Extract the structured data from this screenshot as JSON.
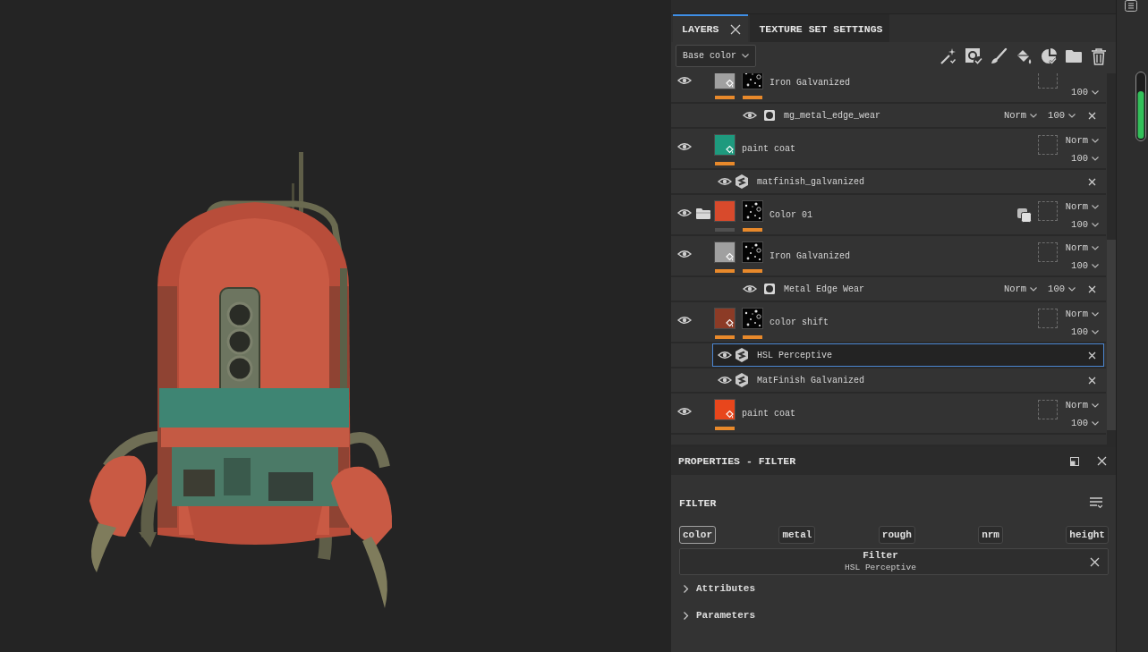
{
  "layers_panel": {
    "tabs": [
      {
        "label": "LAYERS",
        "selected": true,
        "closable": true
      },
      {
        "label": "TEXTURE SET SETTINGS",
        "selected": false,
        "closable": false
      }
    ],
    "channel_dropdown": {
      "value": "Base color"
    },
    "layers": [
      {
        "kind": "layer",
        "name": "Iron Galvanized",
        "visible": true,
        "selected": false,
        "linked": false,
        "thumbs": [
          {
            "kind": "fill",
            "color": "#a0a0a0",
            "active": true
          },
          {
            "kind": "mask",
            "active": true
          }
        ],
        "opacity": "100"
      },
      {
        "kind": "mask-generator",
        "name": "mg_metal_edge_wear",
        "visible": true,
        "selected": false,
        "blend": "Norm",
        "opacity": "100"
      },
      {
        "kind": "layer",
        "name": "paint coat",
        "visible": true,
        "selected": false,
        "linked": false,
        "thumbs": [
          {
            "kind": "fill",
            "color": "#1e9a7e",
            "active": true
          }
        ],
        "blend": "Norm",
        "opacity": "100"
      },
      {
        "kind": "filter",
        "name": "matfinish_galvanized",
        "visible": true,
        "selected": false
      },
      {
        "kind": "folder",
        "name": "Color 01",
        "visible": true,
        "selected": false,
        "linked": true,
        "thumbs": [
          {
            "kind": "texture",
            "color": "#d84a2c",
            "active": false
          },
          {
            "kind": "mask",
            "active": true
          }
        ],
        "blend": "Norm",
        "opacity": "100"
      },
      {
        "kind": "layer",
        "name": "Iron Galvanized",
        "visible": true,
        "selected": false,
        "linked": false,
        "thumbs": [
          {
            "kind": "fill",
            "color": "#a0a0a0",
            "active": true
          },
          {
            "kind": "mask",
            "active": true
          }
        ],
        "blend": "Norm",
        "opacity": "100"
      },
      {
        "kind": "mask-generator",
        "name": "Metal Edge Wear",
        "visible": true,
        "selected": false,
        "blend": "Norm",
        "opacity": "100"
      },
      {
        "kind": "layer",
        "name": "color shift",
        "visible": true,
        "selected": false,
        "linked": false,
        "thumbs": [
          {
            "kind": "fill",
            "color": "#8c3b26",
            "active": true
          },
          {
            "kind": "mask",
            "active": true
          }
        ],
        "blend": "Norm",
        "opacity": "100"
      },
      {
        "kind": "filter",
        "name": "HSL Perceptive",
        "visible": true,
        "selected": true
      },
      {
        "kind": "filter",
        "name": "MatFinish Galvanized",
        "visible": true,
        "selected": false
      },
      {
        "kind": "layer",
        "name": "paint coat",
        "visible": true,
        "selected": false,
        "linked": false,
        "thumbs": [
          {
            "kind": "fill",
            "color": "#e8461c",
            "active": true
          }
        ],
        "blend": "Norm",
        "opacity": "100"
      }
    ]
  },
  "properties_panel": {
    "title": "PROPERTIES - FILTER",
    "section": "FILTER",
    "channels": [
      {
        "label": "color",
        "selected": true
      },
      {
        "label": "metal",
        "selected": false
      },
      {
        "label": "rough",
        "selected": false
      },
      {
        "label": "nrm",
        "selected": false
      },
      {
        "label": "height",
        "selected": false
      }
    ],
    "filter": {
      "label": "Filter",
      "value": "HSL Perceptive"
    },
    "groups": [
      {
        "label": "Attributes",
        "expanded": false
      },
      {
        "label": "Parameters",
        "expanded": false
      }
    ]
  }
}
